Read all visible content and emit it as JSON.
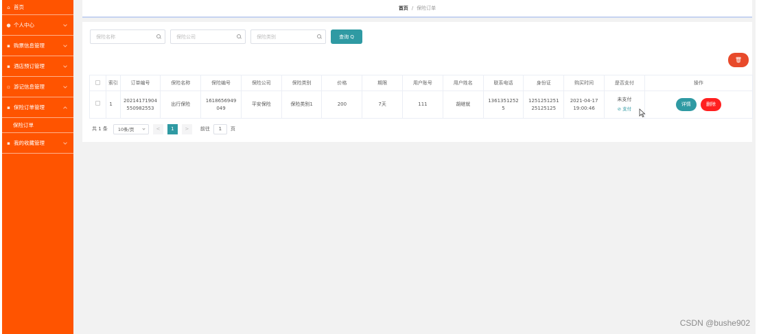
{
  "sidebar": {
    "items": [
      {
        "label": "首页",
        "icon": "home-icon"
      },
      {
        "label": "个人中心",
        "icon": "user-icon"
      },
      {
        "label": "购票信息管理",
        "icon": "ticket-icon"
      },
      {
        "label": "酒店预订管理",
        "icon": "hotel-icon"
      },
      {
        "label": "游记信息管理",
        "icon": "note-icon"
      },
      {
        "label": "保险订单管理",
        "icon": "shield-icon"
      },
      {
        "label": "保险订单",
        "icon": ""
      },
      {
        "label": "我的收藏管理",
        "icon": "star-icon"
      }
    ]
  },
  "breadcrumb": {
    "home": "首页",
    "separator": "/",
    "current": "保险订单"
  },
  "search": {
    "name_placeholder": "保险名称",
    "company_placeholder": "保险公司",
    "category_placeholder": "保险类别",
    "query_label": "查询 Q"
  },
  "bulk_delete_label": "🗑",
  "table": {
    "headers": [
      "",
      "索引",
      "订单编号",
      "保险名称",
      "保险编号",
      "保险公司",
      "保险类别",
      "价格",
      "期限",
      "用户账号",
      "用户姓名",
      "联系电话",
      "身份证",
      "购买时间",
      "是否支付",
      "操作"
    ],
    "rows": [
      {
        "index": "1",
        "order_no": "20214171904550982553",
        "order_no_l1": "20214171904",
        "order_no_l2": "550982553",
        "name": "出行保险",
        "ins_no_l1": "1618656949",
        "ins_no_l2": "049",
        "company": "平安保险",
        "category": "保险类别1",
        "price": "200",
        "term": "7天",
        "account": "111",
        "username": "胡继就",
        "phone_l1": "1361351252",
        "phone_l2": "5",
        "idcard_l1": "1251251251",
        "idcard_l2": "25125125",
        "time_l1": "2021-04-17",
        "time_l2": "19:00:46",
        "paid_status": "未支付",
        "pay_link": "⊘ 支付",
        "detail_label": "详情",
        "delete_label": "删除"
      }
    ]
  },
  "pager": {
    "total": "共 1 条",
    "page_size": "10条/页",
    "prev": "<",
    "current_page": "1",
    "next": ">",
    "goto_label": "前往",
    "goto_value": "1",
    "page_unit": "页"
  },
  "watermark": "CSDN @bushe902"
}
